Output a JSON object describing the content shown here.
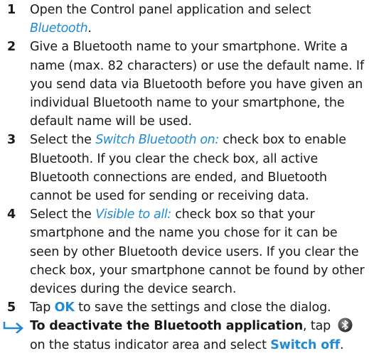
{
  "steps": [
    {
      "num": "1",
      "t1": "Open the Control panel application and select ",
      "link": "Bluetooth",
      "t2": "."
    },
    {
      "num": "2",
      "text": "Give a Bluetooth name to your smartphone. Write a name (max. 82 characters) or use the default name. If you send data via Bluetooth before you have given an individual Bluetooth name to your smartphone, the default name will be used."
    },
    {
      "num": "3",
      "t1": "Select the ",
      "link": "Switch Bluetooth on:",
      "t2": " check box to enable Bluetooth. If you clear the check box, all active Bluetooth connections are ended, and Bluetooth cannot be used for sending or receiving data."
    },
    {
      "num": "4",
      "t1": "Select the ",
      "link": "Visible to all:",
      "t2": " check box so that your smartphone and the name you chose for it can be seen by other Bluetooth device users. If you clear the check box, your smartphone cannot be found by other devices during the device search."
    },
    {
      "num": "5",
      "t1": "Tap ",
      "link": "OK",
      "t2": " to save the settings and close the dialog."
    }
  ],
  "note": {
    "heading": "To deactivate the Bluetooth application",
    "t1": ", tap ",
    "t2": " on the status indicator area and select ",
    "link": "Switch off",
    "t3": "."
  },
  "colors": {
    "accent": "#1f8ad6",
    "text": "#1a1a1a"
  },
  "icons": {
    "arrow": "arrow-right-icon",
    "bluetooth": "bluetooth-icon"
  }
}
